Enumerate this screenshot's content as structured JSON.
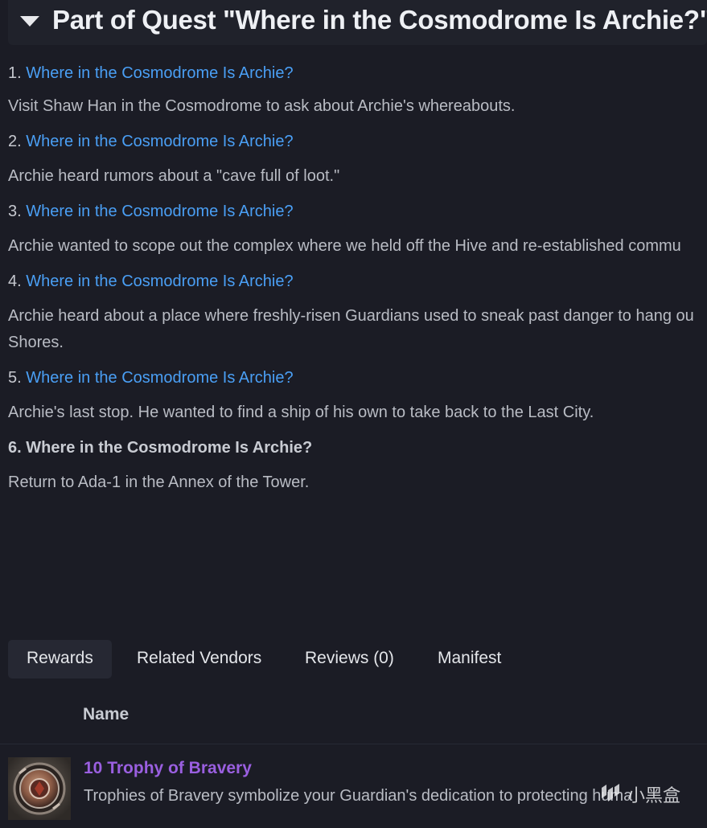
{
  "quest_header": {
    "title": "Part of Quest \"Where in the Cosmodrome Is Archie?\""
  },
  "steps": [
    {
      "number": "1.",
      "title": "Where in the Cosmodrome Is Archie?",
      "description": "Visit Shaw Han in the Cosmodrome to ask about Archie's whereabouts.",
      "current": false
    },
    {
      "number": "2.",
      "title": "Where in the Cosmodrome Is Archie?",
      "description": "Archie heard rumors about a \"cave full of loot.\"",
      "current": false
    },
    {
      "number": "3.",
      "title": "Where in the Cosmodrome Is Archie?",
      "description": "Archie wanted to scope out the complex where we held off the Hive and re-established commu",
      "current": false
    },
    {
      "number": "4.",
      "title": "Where in the Cosmodrome Is Archie?",
      "description": "Archie heard about a place where freshly-risen Guardians used to sneak past danger to hang ou",
      "description_line2": "Shores.",
      "current": false
    },
    {
      "number": "5.",
      "title": "Where in the Cosmodrome Is Archie?",
      "description": "Archie's last stop. He wanted to find a ship of his own to take back to the Last City.",
      "current": false
    },
    {
      "number": "6.",
      "title": "Where in the Cosmodrome Is Archie?",
      "description": "Return to Ada-1 in the Annex of the Tower.",
      "current": true
    }
  ],
  "tabs": [
    {
      "label": "Rewards",
      "active": true
    },
    {
      "label": "Related Vendors",
      "active": false
    },
    {
      "label": "Reviews (0)",
      "active": false
    },
    {
      "label": "Manifest",
      "active": false
    }
  ],
  "rewards_table": {
    "column_name": "Name",
    "rows": [
      {
        "name": "10 Trophy of Bravery",
        "description": "Trophies of Bravery symbolize your Guardian's dedication to protecting huma",
        "icon": "trophy-of-bravery-icon"
      }
    ]
  },
  "watermark": {
    "text": "小黑盒",
    "icon": "heybox-logo-icon"
  },
  "colors": {
    "background": "#1b1c25",
    "link": "#4a9ff5",
    "reward_name": "#9a5fe0",
    "text": "#c6c8cf"
  }
}
